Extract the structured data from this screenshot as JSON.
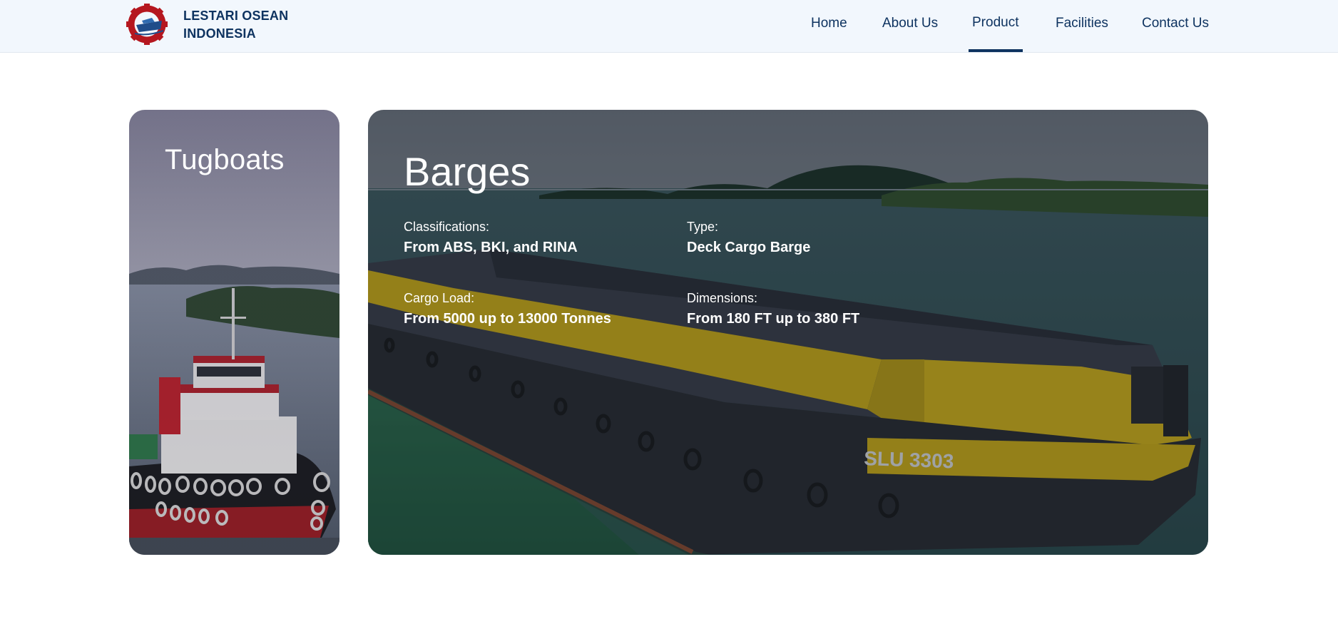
{
  "header": {
    "brand_line1": "LESTARI OSEAN",
    "brand_line2": "INDONESIA",
    "logo_icon": "gear-ship-logo-icon",
    "nav": [
      {
        "label": "Home"
      },
      {
        "label": "About Us"
      },
      {
        "label": "Product",
        "active": true
      },
      {
        "label": "Facilities"
      },
      {
        "label": "Contact Us"
      }
    ]
  },
  "colors": {
    "primary": "#0e3360",
    "header_bg": "#f2f7fd",
    "logo_red": "#b5171f",
    "barge_yellow": "#e6c11d"
  },
  "products": {
    "tugboats": {
      "title": "Tugboats"
    },
    "barges": {
      "title": "Barges",
      "specs": [
        {
          "label": "Classifications:",
          "value": "From ABS, BKI, and RINA"
        },
        {
          "label": "Type:",
          "value": "Deck Cargo Barge"
        },
        {
          "label": "Cargo Load:",
          "value": "From 5000 up to 13000 Tonnes"
        },
        {
          "label": "Dimensions:",
          "value": "From 180 FT up to 380 FT"
        }
      ],
      "hull_marking": "SLU 3303"
    }
  }
}
